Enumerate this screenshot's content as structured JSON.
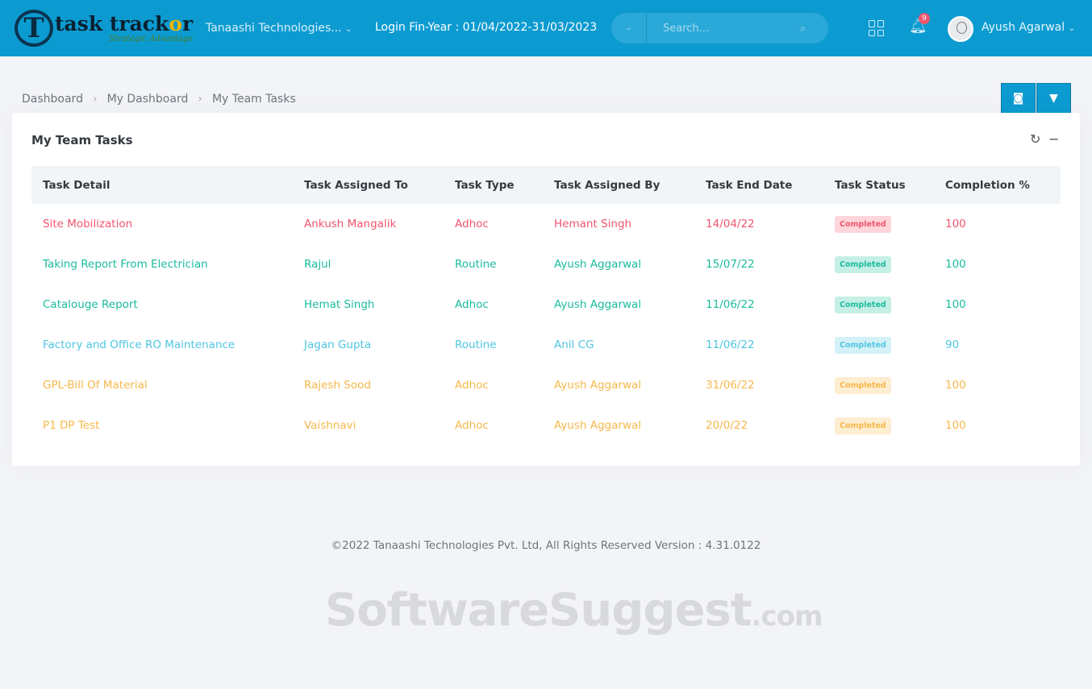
{
  "header": {
    "logo_text": "task trackor",
    "logo_tagline": "Strategic Advantage",
    "org": "Tanaashi Technologies...",
    "fin_year": "Login Fin-Year : 01/04/2022-31/03/2023",
    "search_placeholder": "Search...",
    "notification_count": "9",
    "user": "Ayush Agarwal"
  },
  "breadcrumb": [
    "Dashboard",
    "My Dashboard",
    "My Team Tasks"
  ],
  "card": {
    "title": "My Team Tasks",
    "columns": [
      "Task Detail",
      "Task Assigned To",
      "Task Type",
      "Task Assigned By",
      "Task End Date",
      "Task Status",
      "Completion %"
    ],
    "rows": [
      {
        "detail": "Site Mobilization",
        "to": "Ankush Mangalik",
        "type": "Adhoc",
        "by": "Hemant Singh",
        "end": "14/04/22",
        "status": "Completed",
        "pct": "100",
        "color": "#f1556c",
        "bg": "#fdd5db"
      },
      {
        "detail": "Taking Report From Electrician",
        "to": "Rajul",
        "type": "Routine",
        "by": "Ayush Aggarwal",
        "end": "15/07/22",
        "status": "Completed",
        "pct": "100",
        "color": "#1abc9c",
        "bg": "#c6efe5"
      },
      {
        "detail": "Catalouge Report",
        "to": "Hemat Singh",
        "type": "Adhoc",
        "by": "Ayush Aggarwal",
        "end": "11/06/22",
        "status": "Completed",
        "pct": "100",
        "color": "#1abc9c",
        "bg": "#c6efe5"
      },
      {
        "detail": "Factory and Office RO Maintenance",
        "to": "Jagan Gupta",
        "type": "Routine",
        "by": "Anil CG",
        "end": "11/06/22",
        "status": "Completed",
        "pct": "90",
        "color": "#4fc6e1",
        "bg": "#d5f1f8"
      },
      {
        "detail": "GPL-Bill Of Material",
        "to": "Rajesh Sood",
        "type": "Adhoc",
        "by": "Ayush Aggarwal",
        "end": "31/06/22",
        "status": "Completed",
        "pct": "100",
        "color": "#f7b84b",
        "bg": "#fdedd1"
      },
      {
        "detail": "P1 DP Test",
        "to": "Vaishnavi",
        "type": "Adhoc",
        "by": "Ayush Aggarwal",
        "end": "20/0/22",
        "status": "Completed",
        "pct": "100",
        "color": "#f7b84b",
        "bg": "#fdedd1"
      }
    ]
  },
  "footer": "©2022 Tanaashi Technologies Pvt. Ltd, All Rights Reserved Version : 4.31.0122",
  "watermark": {
    "main": "SoftwareSuggest",
    "suffix": ".com"
  }
}
